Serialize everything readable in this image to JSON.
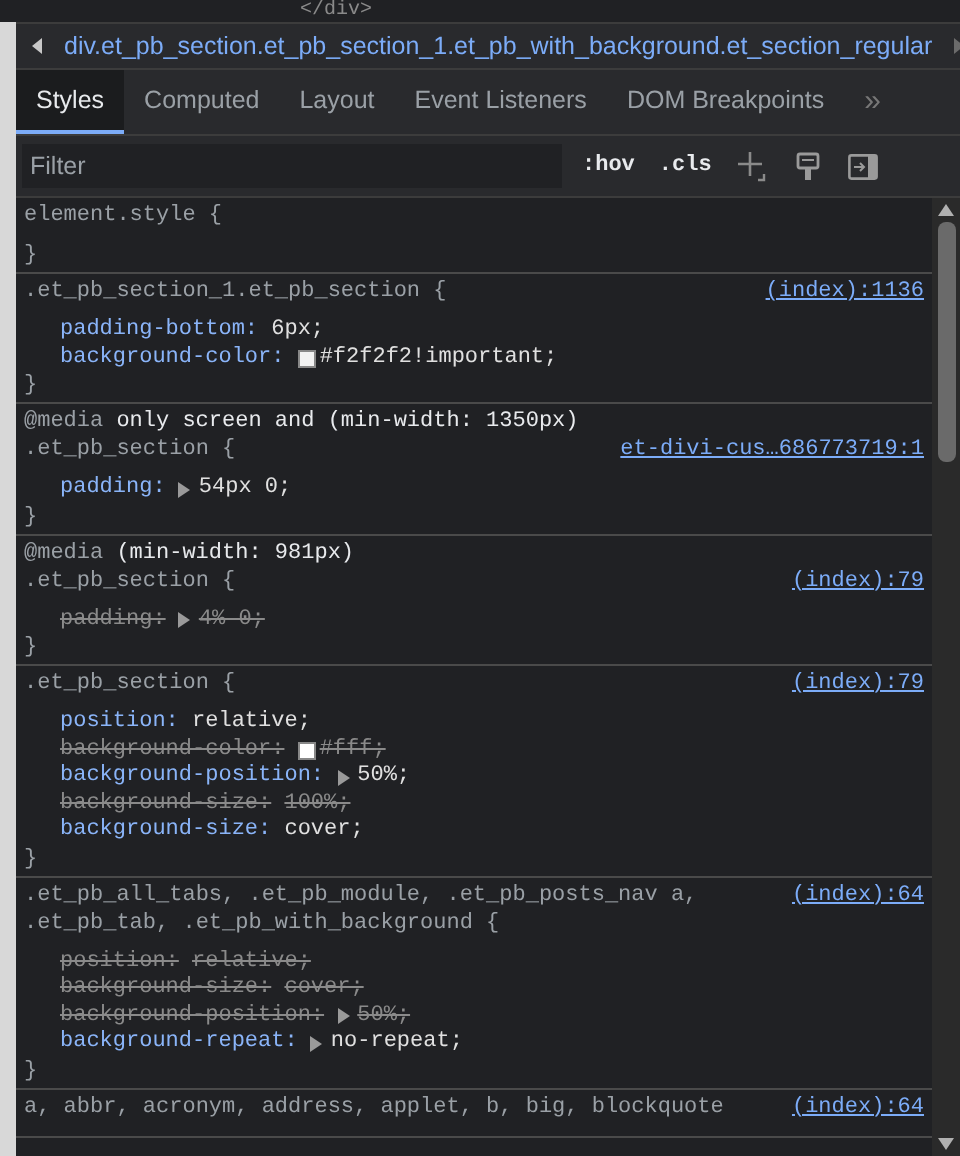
{
  "dom_tree": {
    "line": "</div>"
  },
  "breadcrumb": {
    "path": "div.et_pb_section.et_pb_section_1.et_pb_with_background.et_section_regular"
  },
  "tabs": [
    {
      "label": "Styles",
      "selected": true
    },
    {
      "label": "Computed",
      "selected": false
    },
    {
      "label": "Layout",
      "selected": false
    },
    {
      "label": "Event Listeners",
      "selected": false
    },
    {
      "label": "DOM Breakpoints",
      "selected": false
    }
  ],
  "tabs_overflow": "»",
  "filter": {
    "placeholder": "Filter",
    "buttons": [
      ":hov",
      ".cls"
    ]
  },
  "rules": [
    {
      "selector": "element.style {",
      "close": "}"
    },
    {
      "selector": ".et_pb_section_1.et_pb_section {",
      "source": "(index):1136",
      "close": "}",
      "properties": [
        {
          "kind": "plain",
          "name": "padding-bottom:",
          "value": "6px;",
          "overridden": false
        },
        {
          "kind": "swatch",
          "name": "background-color:",
          "value": "#f2f2f2!important;",
          "color": "#f2f2f2",
          "overridden": false
        }
      ]
    },
    {
      "at_rule": "@media",
      "condition": "only screen and (min-width: 1350px)",
      "selector": ".et_pb_section {",
      "source": "et-divi-cus…686773719:1",
      "close": "}",
      "properties": [
        {
          "kind": "expand",
          "name": "padding:",
          "value": "54px 0;",
          "overridden": false
        }
      ]
    },
    {
      "at_rule": "@media",
      "condition": "(min-width: 981px)",
      "selector": ".et_pb_section {",
      "source": "(index):79",
      "close": "}",
      "properties": [
        {
          "kind": "expand",
          "name": "padding:",
          "value": "4% 0;",
          "overridden": true
        }
      ]
    },
    {
      "selector": ".et_pb_section {",
      "source": "(index):79",
      "close": "}",
      "properties": [
        {
          "kind": "plain",
          "name": "position:",
          "value": "relative;",
          "overridden": false
        },
        {
          "kind": "swatch",
          "name": "background-color:",
          "value": "#fff;",
          "color": "#ffffff",
          "overridden": true
        },
        {
          "kind": "expand",
          "name": "background-position:",
          "value": "50%;",
          "overridden": false
        },
        {
          "kind": "plain",
          "name": "background-size:",
          "value": "100%;",
          "overridden": true
        },
        {
          "kind": "plain",
          "name": "background-size:",
          "value": "cover;",
          "overridden": false
        }
      ]
    },
    {
      "selector": ".et_pb_all_tabs, .et_pb_module, .et_pb_posts_nav a,\n.et_pb_tab, .et_pb_with_background {",
      "source": "(index):64",
      "close": "}",
      "properties": [
        {
          "kind": "plain",
          "name": "position:",
          "value": "relative;",
          "overridden": true
        },
        {
          "kind": "plain",
          "name": "background-size:",
          "value": "cover;",
          "overridden": true
        },
        {
          "kind": "expand",
          "name": "background-position:",
          "value": "50%;",
          "overridden": true
        },
        {
          "kind": "expand",
          "name": "background-repeat:",
          "value": "no-repeat;",
          "overridden": false
        }
      ]
    },
    {
      "selector": "a, abbr, acronym, address, applet, b, big, blockquote",
      "source": "(index):64"
    }
  ]
}
